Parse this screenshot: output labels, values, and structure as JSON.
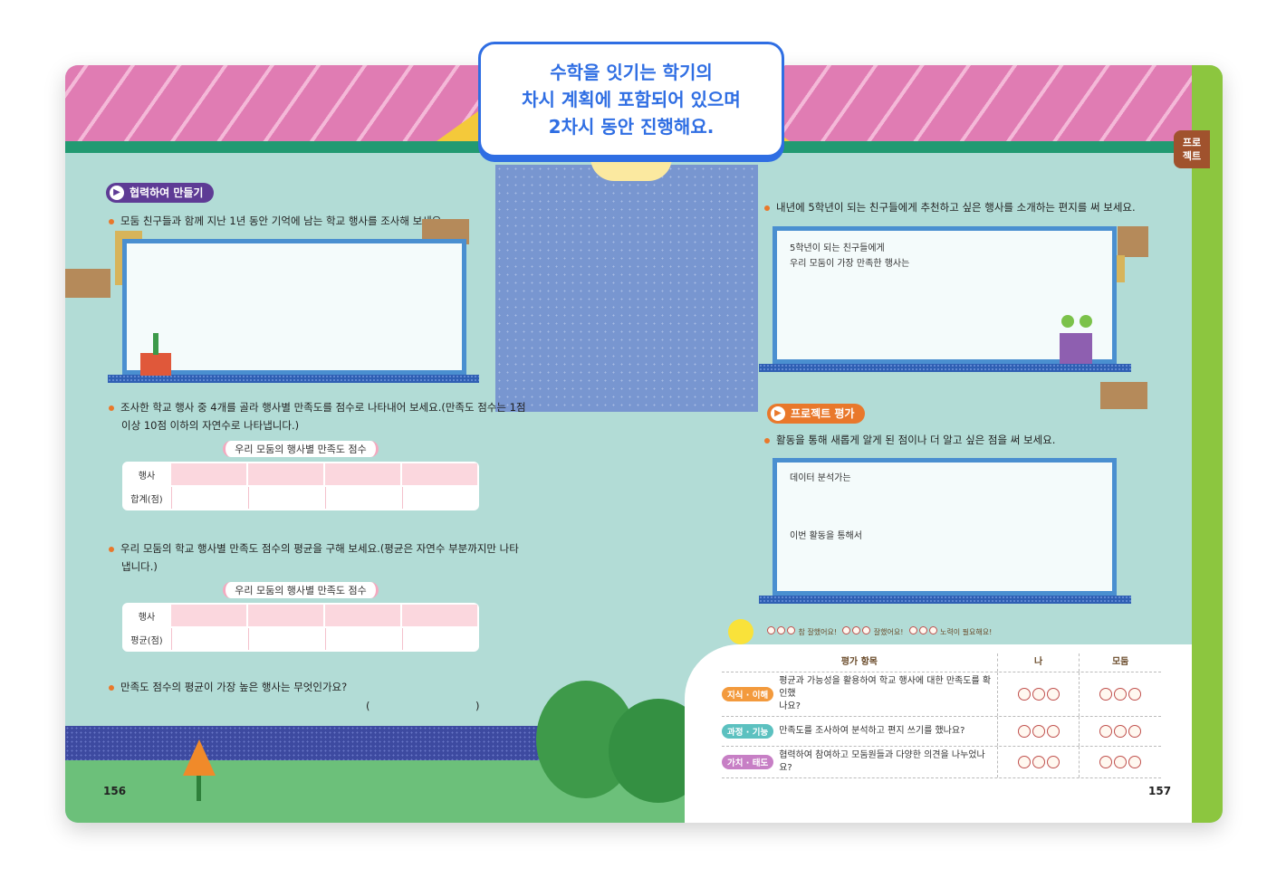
{
  "callout": {
    "line1": "수학을 잇기는 학기의",
    "line2": "차시 계획에 포함되어 있으며",
    "line3": "2차시 동안 진행해요."
  },
  "side_tab": {
    "line1": "프로",
    "line2": "젝트"
  },
  "left_page": {
    "section_label": "협력하여 만들기",
    "q1": "모둠 친구들과 함께 지난 1년 동안 기억에 남는 학교 행사를 조사해 보세요.",
    "q2_line1": "조사한 학교 행사 중 4개를 골라 행사별 만족도를 점수로 나타내어 보세요.(만족도 점수는 1점",
    "q2_line2": "이상 10점 이하의 자연수로 나타냅니다.)",
    "table1": {
      "title": "우리 모둠의 행사별 만족도 점수",
      "row1_head": "행사",
      "row2_head": "합계(점)"
    },
    "q3_line1": "우리 모둠의 학교 행사별 만족도 점수의 평균을 구해 보세요.(평균은 자연수 부분까지만 나타",
    "q3_line2": "냅니다.)",
    "table2": {
      "title": "우리 모둠의 행사별 만족도 점수",
      "row1_head": "행사",
      "row2_head": "평균(점)"
    },
    "q4": "만족도 점수의 평균이 가장 높은 행사는 무엇인가요?",
    "answer_open": "(",
    "answer_close": ")",
    "page_number": "156"
  },
  "right_page": {
    "q5": "내년에 5학년이 되는 친구들에게 추천하고 싶은 행사를 소개하는 편지를 써 보세요.",
    "letter_line1": "5학년이 되는 친구들에게",
    "letter_line2": "우리 모둠이 가장 만족한 행사는",
    "section_label": "프로젝트 평가",
    "q6": "활동을 통해 새롭게 알게 된 점이나 더 알고 싶은 점을 써 보세요.",
    "reflect_line1": "데이터 분석가는",
    "reflect_line2": "이번 활동을 통해서",
    "legend": {
      "good": "참 잘했어요!",
      "ok": "잘했어요!",
      "try": "노력이 필요해요!"
    },
    "eval": {
      "col_item": "평가 항목",
      "col_me": "나",
      "col_group": "모둠",
      "rows": [
        {
          "badge": "지식 · 이해",
          "badge_color": "#f39a3d",
          "text1": "평균과 가능성을 활용하여 학교 행사에 대한 만족도를 확인했",
          "text2": "나요?"
        },
        {
          "badge": "과정 · 기능",
          "badge_color": "#5cc1c0",
          "text1": "만족도를 조사하여 분석하고 편지 쓰기를 했나요?",
          "text2": ""
        },
        {
          "badge": "가치 · 태도",
          "badge_color": "#c77fc5",
          "text1": "협력하여 참여하고 모둠원들과 다양한 의견을 나누었나요?",
          "text2": ""
        }
      ]
    },
    "page_number": "157"
  }
}
